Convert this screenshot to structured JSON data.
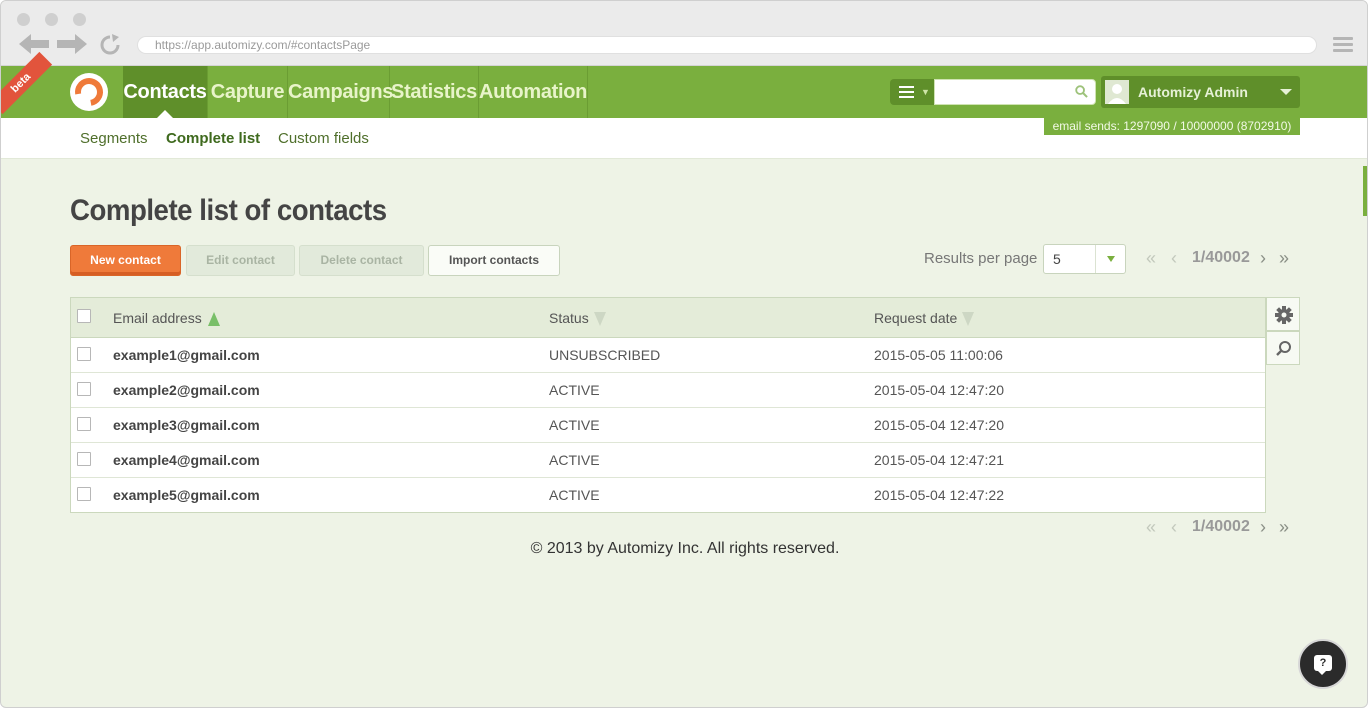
{
  "browser": {
    "url": "https://app.automizy.com/#contactsPage"
  },
  "app": {
    "badge": "beta",
    "nav": [
      {
        "label": "Contacts",
        "active": true
      },
      {
        "label": "Capture",
        "active": false
      },
      {
        "label": "Campaigns",
        "active": false
      },
      {
        "label": "Statistics",
        "active": false
      },
      {
        "label": "Automation",
        "active": false
      }
    ],
    "search": {
      "value": "",
      "placeholder": ""
    },
    "user": {
      "name": "Automizy Admin"
    },
    "email_sends": "email sends: 1297090 / 10000000 (8702910)",
    "accent": "#7aaf3e",
    "primary": "#ef7a3a"
  },
  "subnav": [
    {
      "label": "Segments",
      "active": false
    },
    {
      "label": "Complete list",
      "active": true
    },
    {
      "label": "Custom fields",
      "active": false
    }
  ],
  "page": {
    "title": "Complete list of contacts",
    "buttons": {
      "new": "New contact",
      "edit": "Edit contact",
      "delete": "Delete contact",
      "import": "Import contacts"
    },
    "results_per_page": {
      "label": "Results per page",
      "value": "5"
    },
    "pager_top": {
      "text": "1/40002"
    },
    "pager_bottom": {
      "text": "1/40002"
    }
  },
  "table": {
    "columns": [
      "Email address",
      "Status",
      "Request date"
    ],
    "rows": [
      {
        "email": "example1@gmail.com",
        "status": "UNSUBSCRIBED",
        "date": "2015-05-05 11:00:06"
      },
      {
        "email": "example2@gmail.com",
        "status": "ACTIVE",
        "date": "2015-05-04 12:47:20"
      },
      {
        "email": "example3@gmail.com",
        "status": "ACTIVE",
        "date": "2015-05-04 12:47:20"
      },
      {
        "email": "example4@gmail.com",
        "status": "ACTIVE",
        "date": "2015-05-04 12:47:21"
      },
      {
        "email": "example5@gmail.com",
        "status": "ACTIVE",
        "date": "2015-05-04 12:47:22"
      }
    ]
  },
  "footer": {
    "text": "© 2013 by Automizy Inc. All rights reserved."
  },
  "icons": {
    "help": "?"
  }
}
